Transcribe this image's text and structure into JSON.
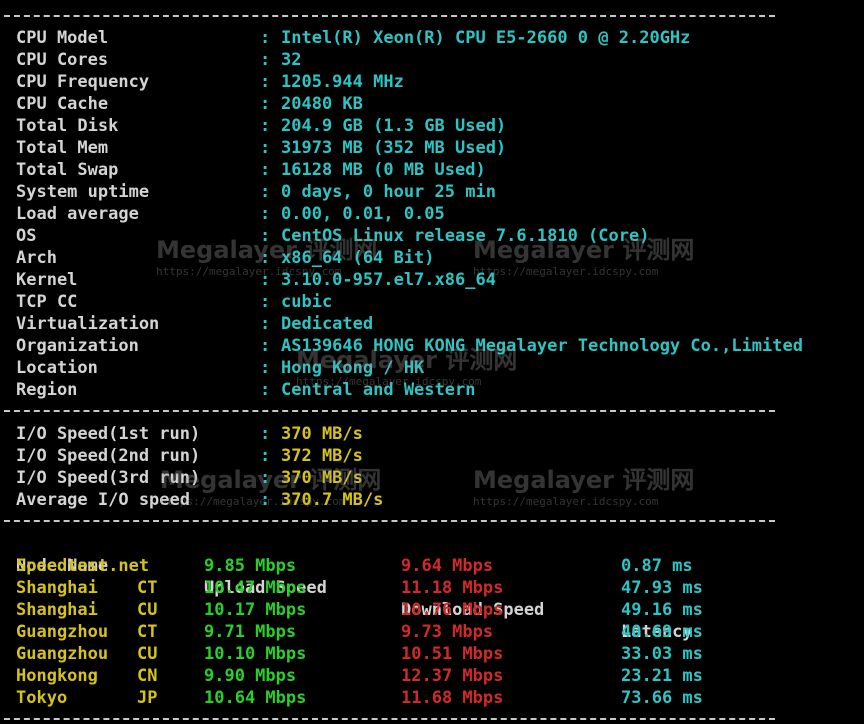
{
  "system": [
    {
      "label": "CPU Model",
      "value": "Intel(R) Xeon(R) CPU E5-2660 0 @ 2.20GHz"
    },
    {
      "label": "CPU Cores",
      "value": "32"
    },
    {
      "label": "CPU Frequency",
      "value": "1205.944 MHz"
    },
    {
      "label": "CPU Cache",
      "value": "20480 KB"
    },
    {
      "label": "Total Disk",
      "value": "204.9 GB (1.3 GB Used)"
    },
    {
      "label": "Total Mem",
      "value": "31973 MB (352 MB Used)"
    },
    {
      "label": "Total Swap",
      "value": "16128 MB (0 MB Used)"
    },
    {
      "label": "System uptime",
      "value": "0 days, 0 hour 25 min"
    },
    {
      "label": "Load average",
      "value": "0.00, 0.01, 0.05"
    },
    {
      "label": "OS",
      "value": "CentOS Linux release 7.6.1810 (Core)"
    },
    {
      "label": "Arch",
      "value": "x86_64 (64 Bit)"
    },
    {
      "label": "Kernel",
      "value": "3.10.0-957.el7.x86_64"
    },
    {
      "label": "TCP CC",
      "value": "cubic"
    },
    {
      "label": "Virtualization",
      "value": "Dedicated"
    },
    {
      "label": "Organization",
      "value": "AS139646 HONG KONG Megalayer Technology Co.,Limited"
    },
    {
      "label": "Location",
      "value": "Hong Kong / HK"
    },
    {
      "label": "Region",
      "value": "Central and Western"
    }
  ],
  "colon": ":",
  "io": [
    {
      "label": "I/O Speed(1st run)",
      "value": "370 MB/s"
    },
    {
      "label": "I/O Speed(2nd run)",
      "value": "372 MB/s"
    },
    {
      "label": "I/O Speed(3rd run)",
      "value": "370 MB/s"
    },
    {
      "label": "Average I/O speed",
      "value": "370.7 MB/s"
    }
  ],
  "speedtest": {
    "headers": {
      "node": "Node Name",
      "upload": "Upload Speed",
      "download": "Download Speed",
      "latency": "Latency"
    },
    "rows": [
      {
        "node": "Speedtest.net",
        "isp": "",
        "upload": "9.85 Mbps",
        "download": "9.64 Mbps",
        "latency": "0.87 ms"
      },
      {
        "node": "Shanghai",
        "isp": "CT",
        "upload": "10.47 Mbps",
        "download": "11.18 Mbps",
        "latency": "47.93 ms"
      },
      {
        "node": "Shanghai",
        "isp": "CU",
        "upload": "10.17 Mbps",
        "download": "10.76 Mbps",
        "latency": "49.16 ms"
      },
      {
        "node": "Guangzhou",
        "isp": "CT",
        "upload": "9.71 Mbps",
        "download": "9.73 Mbps",
        "latency": "40.69 ms"
      },
      {
        "node": "Guangzhou",
        "isp": "CU",
        "upload": "10.10 Mbps",
        "download": "10.51 Mbps",
        "latency": "33.03 ms"
      },
      {
        "node": "Hongkong",
        "isp": "CN",
        "upload": "9.90 Mbps",
        "download": "12.37 Mbps",
        "latency": "23.21 ms"
      },
      {
        "node": "Tokyo",
        "isp": "JP",
        "upload": "10.64 Mbps",
        "download": "11.68 Mbps",
        "latency": "73.66 ms"
      }
    ]
  },
  "watermark": {
    "brand": "Megalayer 评测网",
    "url": "https://megalayer.idcspy.com"
  },
  "colors": {
    "background": "#000000",
    "label": "#d4d4d4",
    "cyan": "#2ec4c4",
    "yellow": "#d6c21c",
    "green": "#2ad02a",
    "red": "#d12a2a"
  }
}
